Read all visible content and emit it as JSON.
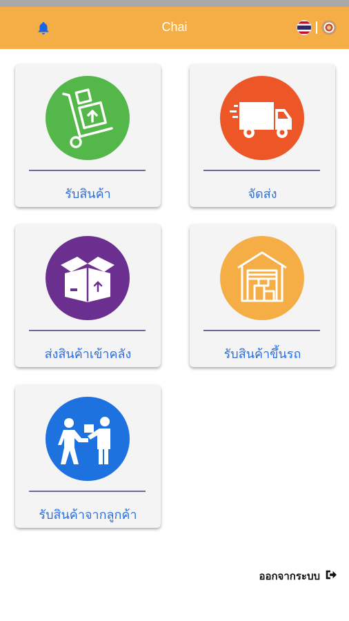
{
  "header": {
    "title": "Chai",
    "bg_color": "#f5ae45",
    "icons": [
      "bell-icon",
      "thai-flag-icon",
      "profile-icon"
    ]
  },
  "menu": [
    {
      "label": "รับสินค้า",
      "color": "#53b849",
      "icon": "hand-truck-icon"
    },
    {
      "label": "จัดส่ง",
      "color": "#ed5728",
      "icon": "delivery-truck-icon"
    },
    {
      "label": "ส่งสินค้าเข้าคลัง",
      "color": "#6b2f8f",
      "icon": "open-box-icon"
    },
    {
      "label": "รับสินค้าขึ้นรถ",
      "color": "#f5ae45",
      "icon": "warehouse-icon"
    },
    {
      "label": "รับสินค้าจากลูกค้า",
      "color": "#1d72e0",
      "icon": "handover-icon"
    }
  ],
  "logout": {
    "label": "ออกจากระบบ",
    "icon": "sign-out-icon"
  }
}
